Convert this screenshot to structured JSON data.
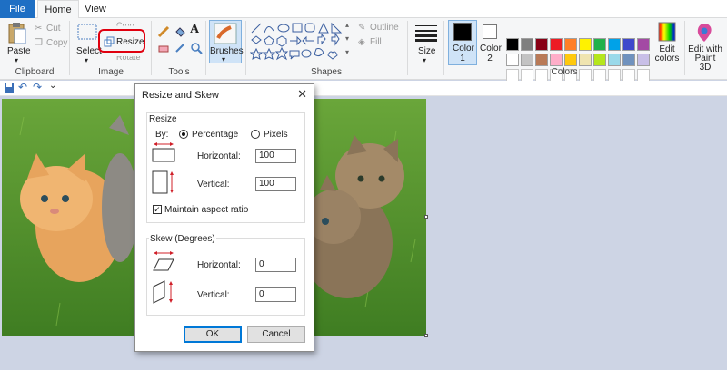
{
  "tabs": [
    {
      "label": "File"
    },
    {
      "label": "Home"
    },
    {
      "label": "View"
    }
  ],
  "ribbon": {
    "clipboard": {
      "group": "Clipboard",
      "paste": "Paste",
      "cut": "Cut",
      "copy": "Copy"
    },
    "image": {
      "group": "Image",
      "select": "Select",
      "crop": "Crop",
      "resize": "Resize",
      "rotate": "Rotate"
    },
    "tools": {
      "group": "Tools"
    },
    "brushes": {
      "label": "Brushes"
    },
    "shapes": {
      "group": "Shapes",
      "outline": "Outline",
      "fill": "Fill"
    },
    "size": {
      "label": "Size"
    },
    "colors": {
      "group": "Colors",
      "color1": "Color\n1",
      "color2": "Color\n2",
      "edit": "Edit\ncolors",
      "row1": [
        "#000000",
        "#7f7f7f",
        "#880015",
        "#ed1c24",
        "#ff7f27",
        "#fff200",
        "#22b14c",
        "#00a2e8",
        "#3f48cc",
        "#a349a4"
      ],
      "row2": [
        "#ffffff",
        "#c3c3c3",
        "#b97a57",
        "#ffaec9",
        "#ffc90e",
        "#efe4b0",
        "#b5e61d",
        "#99d9ea",
        "#7092be",
        "#c8bfe7"
      ]
    },
    "paint3d": {
      "label": "Edit with\nPaint 3D"
    },
    "accent_highlight": "#e0000f"
  },
  "dialog": {
    "title": "Resize and Skew",
    "resize": {
      "title": "Resize",
      "by_label": "By:",
      "percentage": "Percentage",
      "pixels": "Pixels",
      "horizontal_label": "Horizontal:",
      "horizontal_value": "100",
      "vertical_label": "Vertical:",
      "vertical_value": "100",
      "aspect_label": "Maintain aspect ratio"
    },
    "skew": {
      "title": "Skew (Degrees)",
      "horizontal_label": "Horizontal:",
      "horizontal_value": "0",
      "vertical_label": "Vertical:",
      "vertical_value": "0"
    },
    "ok": "OK",
    "cancel": "Cancel"
  }
}
